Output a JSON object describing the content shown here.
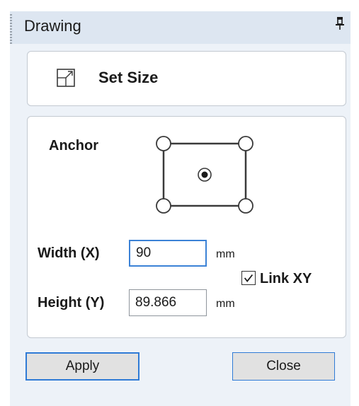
{
  "header": {
    "title": "Drawing",
    "pin_icon": "pin-icon"
  },
  "set_size": {
    "icon": "resize-icon",
    "label": "Set Size"
  },
  "form": {
    "anchor_label": "Anchor",
    "anchor_selected": "center",
    "width_label": "Width (X)",
    "width_value": "90",
    "width_unit": "mm",
    "link_label": "Link XY",
    "link_checked": true,
    "height_label": "Height (Y)",
    "height_value": "89.866",
    "height_unit": "mm"
  },
  "buttons": {
    "apply": "Apply",
    "close": "Close"
  },
  "colors": {
    "panel_bg": "#edf2f8",
    "header_bg": "#dde6f1",
    "focus_border": "#3b82d6",
    "button_border": "#2f7bd6"
  }
}
